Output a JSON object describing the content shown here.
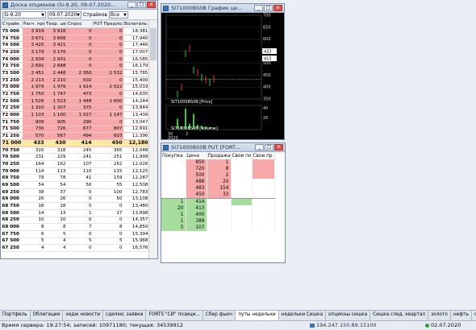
{
  "board": {
    "title": "Доска опционов (Si-9.20, 09.07.2020...",
    "underlying": "Si-9.20",
    "expiry": "09.07.2020",
    "strike_label": "Страйков",
    "strike_value": "Все",
    "columns": [
      "Страйк",
      "Расч. прем.",
      "Теор. цена",
      "Спрос",
      "PUT Предложение",
      "Волатиль"
    ],
    "rows": [
      [
        "75 000",
        "3 919",
        "3 916",
        "0",
        "0",
        "18,381"
      ],
      [
        "74 750",
        "3 671",
        "3 668",
        "0",
        "0",
        "17,940"
      ],
      [
        "74 500",
        "3 425",
        "3 421",
        "0",
        "0",
        "17,446"
      ],
      [
        "74 250",
        "3 179",
        "3 176",
        "0",
        "0",
        "17,007"
      ],
      [
        "74 000",
        "2 934",
        "2 931",
        "0",
        "0",
        "16,585"
      ],
      [
        "73 750",
        "2 691",
        "2 688",
        "0",
        "0",
        "16,179"
      ],
      [
        "73 500",
        "2 451",
        "2 448",
        "2 360",
        "2 532",
        "15,785"
      ],
      [
        "73 250",
        "2 213",
        "2 210",
        "502",
        "0",
        "15,400"
      ],
      [
        "73 000",
        "1 979",
        "1 976",
        "1 914",
        "2 022",
        "15,019"
      ],
      [
        "72 750",
        "1 750",
        "1 747",
        "473",
        "0",
        "14,635"
      ],
      [
        "72 500",
        "1 526",
        "1 523",
        "1 448",
        "1 600",
        "14,244"
      ],
      [
        "72 250",
        "1 310",
        "1 307",
        "375",
        "0",
        "13,844"
      ],
      [
        "72 000",
        "1 103",
        "1 100",
        "1 027",
        "1 147",
        "13,439"
      ],
      [
        "71 750",
        "909",
        "905",
        "290",
        "0",
        "13,047"
      ],
      [
        "71 500",
        "730",
        "726",
        "677",
        "807",
        "12,691"
      ],
      [
        "71 250",
        "570",
        "567",
        "494",
        "603",
        "12,396"
      ],
      [
        "71 000",
        "433",
        "430",
        "414",
        "450",
        "12,180"
      ],
      [
        "70 750",
        "320",
        "318",
        "245",
        "365",
        "12,048"
      ],
      [
        "70 500",
        "231",
        "229",
        "241",
        "251",
        "11,999"
      ],
      [
        "70 250",
        "164",
        "162",
        "107",
        "252",
        "12,026"
      ],
      [
        "70 000",
        "114",
        "113",
        "110",
        "115",
        "12,125"
      ],
      [
        "69 750",
        "79",
        "78",
        "41",
        "159",
        "12,287"
      ],
      [
        "69 500",
        "54",
        "54",
        "50",
        "55",
        "12,508"
      ],
      [
        "69 250",
        "38",
        "37",
        "0",
        "100",
        "12,783"
      ],
      [
        "69 000",
        "26",
        "26",
        "0",
        "50",
        "13,108"
      ],
      [
        "68 750",
        "18",
        "18",
        "0",
        "0",
        "13,480"
      ],
      [
        "68 500",
        "14",
        "13",
        "1",
        "17",
        "13,898"
      ],
      [
        "68 250",
        "10",
        "10",
        "0",
        "0",
        "14,357"
      ],
      [
        "68 000",
        "8",
        "8",
        "7",
        "8",
        "14,850"
      ],
      [
        "67 750",
        "6",
        "5",
        "0",
        "0",
        "15,394"
      ],
      [
        "67 500",
        "5",
        "4",
        "5",
        "5",
        "15,968"
      ],
      [
        "67 250",
        "4",
        "4",
        "0",
        "0",
        "16,576"
      ]
    ],
    "atm_index": 16,
    "colors": {
      "itm": "#f7a8a8",
      "atm": "#fbe8a6"
    }
  },
  "chart": {
    "title": "SI71000BS0B График це...",
    "price_legend": "SI71000BS0B [Price]",
    "volume_legend": "SI71000BS0B [Volume]",
    "y_ticks": [
      "700",
      "650",
      "600",
      "550",
      "500",
      "450",
      "400",
      "350"
    ],
    "vol_ticks": [
      "40",
      "20"
    ],
    "x_labels": [
      "30",
      "2"
    ],
    "x_year": "2020",
    "last_labels": [
      "433",
      "415"
    ]
  },
  "chart_data": {
    "type": "bar",
    "title": "",
    "ylim": [
      350,
      700
    ],
    "series": [
      {
        "name": "SI71000BS0B [Price]",
        "values": [
          370,
          400,
          540,
          560,
          470,
          460,
          440,
          430,
          420,
          433
        ]
      },
      {
        "name": "SI71000BS0B [Volume]",
        "values": [
          20,
          5,
          40,
          10,
          30,
          8,
          6,
          4,
          3,
          2
        ]
      }
    ],
    "x": [
      "30",
      "",
      "",
      "",
      "",
      "2",
      "",
      "",
      "",
      ""
    ]
  },
  "depth": {
    "title": "SI71000BS0B PUT [FORT...",
    "columns": [
      "Покупка",
      "Цена",
      "Продажа",
      "Свои по",
      "Свои пр"
    ],
    "rows": [
      {
        "buy": "",
        "price": "850",
        "sell": "1"
      },
      {
        "buy": "",
        "price": "720",
        "sell": "8"
      },
      {
        "buy": "",
        "price": "500",
        "sell": "2"
      },
      {
        "buy": "",
        "price": "488",
        "sell": "20"
      },
      {
        "buy": "",
        "price": "483",
        "sell": "154"
      },
      {
        "buy": "",
        "price": "450",
        "sell": "33"
      },
      {
        "buy": "1",
        "price": "414",
        "sell": ""
      },
      {
        "buy": "20",
        "price": "413",
        "sell": ""
      },
      {
        "buy": "1",
        "price": "400",
        "sell": ""
      },
      {
        "buy": "1",
        "price": "389",
        "sell": ""
      },
      {
        "buy": "5",
        "price": "107",
        "sell": ""
      }
    ]
  },
  "tabs": [
    "Портфель",
    "Облигации",
    "хедж новости",
    "сделки; заявки",
    "FORTS \"СИ\" позици...",
    "Сбер фьюч",
    "путы недельки",
    "недельки Сишка",
    "опционы сишка",
    "Сишка след. квартал",
    "золото",
    "нефть",
    "опционы ртс",
    "анализ"
  ],
  "active_tab": 6,
  "status": {
    "server": "Время сервера: 19:27:54; записей: 10971180; текущая: 34539912",
    "ip": "194.247.150.89:15100",
    "date": "02.07.2020"
  }
}
